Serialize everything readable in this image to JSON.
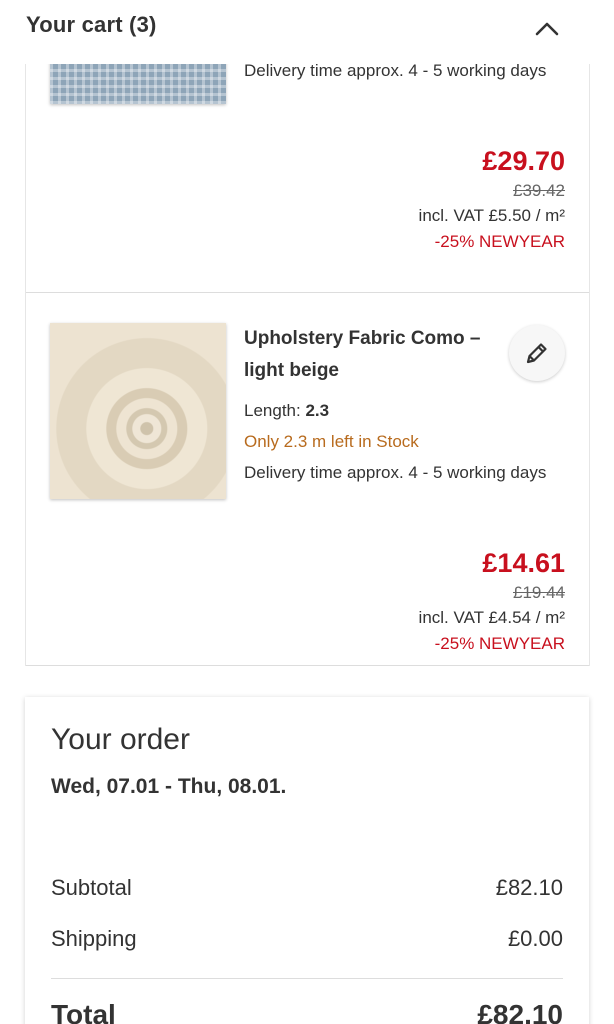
{
  "header": {
    "title": "Your cart (3)",
    "collapse_icon": "chevron-up-icon"
  },
  "items": [
    {
      "delivery": "Delivery time approx. 4 - 5 working days",
      "price": "£29.70",
      "old_price": "£39.42",
      "vat": "incl. VAT £5.50 / m²",
      "promo": "-25% NEWYEAR"
    },
    {
      "name": "Upholstery Fabric Como – light beige",
      "length_label": "Length:",
      "length_value": "2.3",
      "stock": "Only 2.3 m left in Stock",
      "delivery": "Delivery time approx. 4 - 5 working days",
      "price": "£14.61",
      "old_price": "£19.44",
      "vat": "incl. VAT £4.54 / m²",
      "promo": "-25% NEWYEAR",
      "edit_icon": "pencil-icon"
    }
  ],
  "order": {
    "title": "Your order",
    "dates": "Wed, 07.01 - Thu, 08.01.",
    "subtotal_label": "Subtotal",
    "subtotal_value": "£82.10",
    "shipping_label": "Shipping",
    "shipping_value": "£0.00",
    "total_label": "Total",
    "total_value": "£82.10"
  },
  "colors": {
    "price_red": "#c8101e",
    "stock_orange": "#b86b1e",
    "text": "#333333"
  }
}
